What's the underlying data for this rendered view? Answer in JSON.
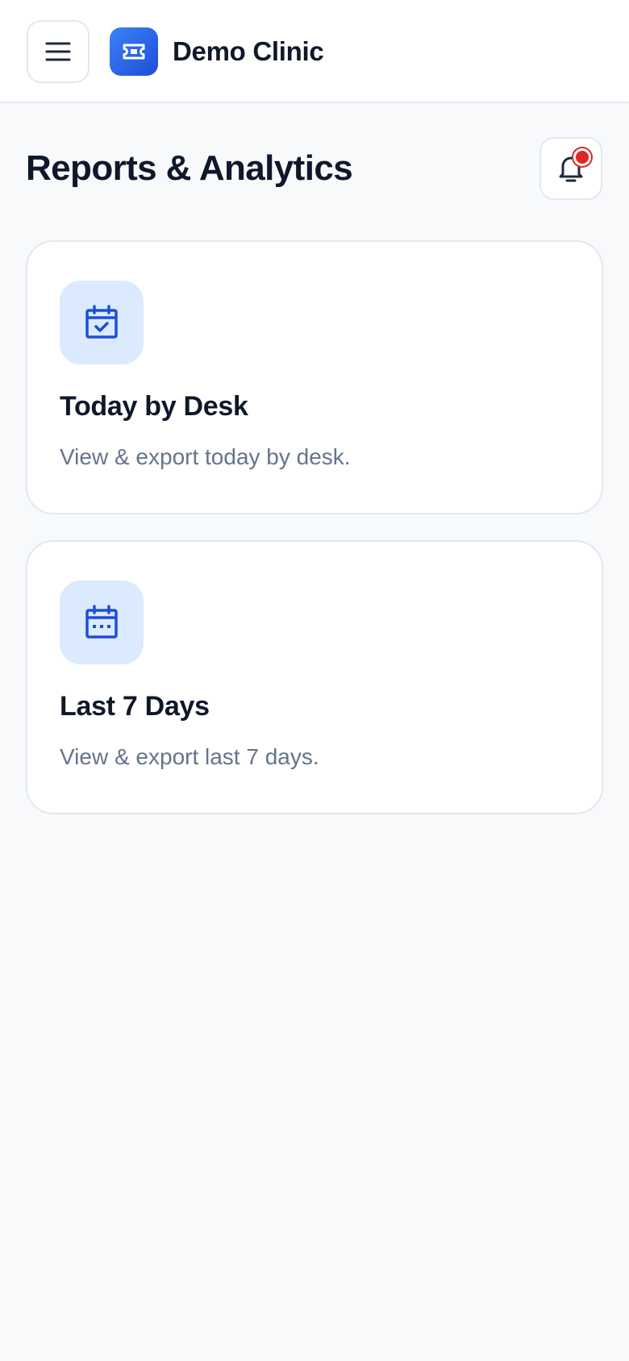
{
  "header": {
    "menu_icon": "hamburger-menu-icon",
    "logo_icon": "ticket-icon",
    "brand_name": "Demo Clinic",
    "accent_color": "#2563eb"
  },
  "page": {
    "title": "Reports & Analytics",
    "notification_icon": "bell-icon",
    "notification_badge_color": "#dc2626"
  },
  "reports": [
    {
      "title": "Today by Desk",
      "description": "View & export today by desk.",
      "icon": "calendar-check-icon"
    },
    {
      "title": "Last 7 Days",
      "description": "View & export last 7 days.",
      "icon": "calendar-dots-icon"
    }
  ]
}
